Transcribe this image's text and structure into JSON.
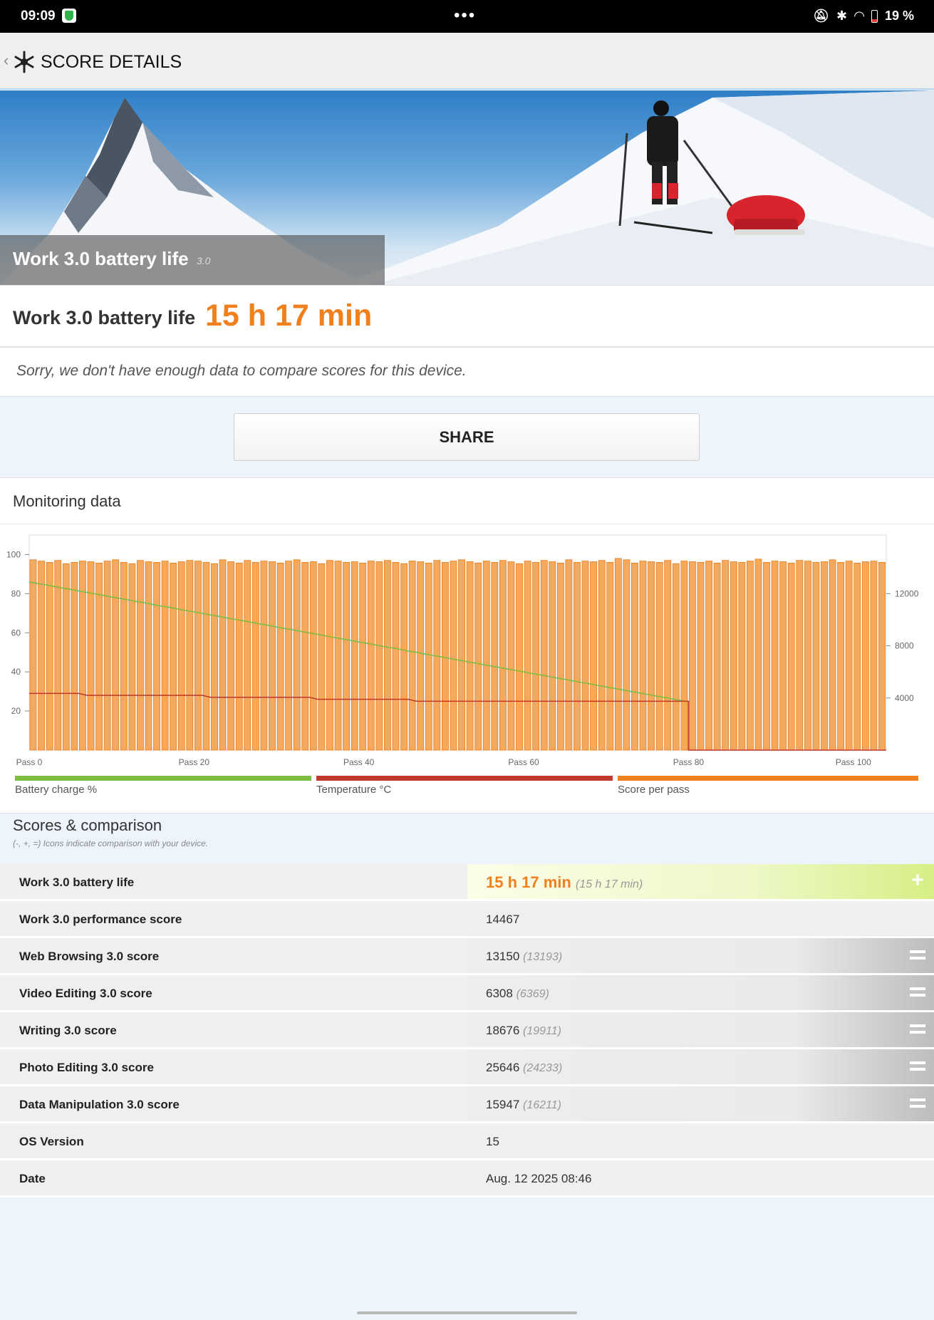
{
  "status_bar": {
    "time": "09:09",
    "battery": "19 %"
  },
  "app_bar": {
    "title": "SCORE DETAILS"
  },
  "hero": {
    "title": "Work 3.0 battery life",
    "version": "3.0"
  },
  "result": {
    "label": "Work 3.0 battery life",
    "value": "15 h 17 min"
  },
  "compare_message": "Sorry, we don't have enough data to compare scores for this device.",
  "share_label": "SHARE",
  "monitoring": {
    "title": "Monitoring data",
    "legend": [
      {
        "name": "Battery charge %",
        "color": "#7dbd42"
      },
      {
        "name": "Temperature °C",
        "color": "#c0392b"
      },
      {
        "name": "Score per pass",
        "color": "#f07f1d"
      }
    ]
  },
  "chart_data": {
    "type": "bar",
    "passes": 104,
    "x_ticks": [
      "Pass 0",
      "Pass 20",
      "Pass 40",
      "Pass 60",
      "Pass 80",
      "Pass 100"
    ],
    "left_axis": {
      "ticks": [
        20,
        40,
        60,
        80,
        100
      ],
      "range": [
        0,
        110
      ]
    },
    "right_axis": {
      "ticks": [
        4000,
        8000,
        12000
      ],
      "range": [
        0,
        16500
      ]
    },
    "series": [
      {
        "name": "Score per pass",
        "axis": "right",
        "base": 14467,
        "values": [
          14600,
          14500,
          14400,
          14550,
          14300,
          14400,
          14500,
          14450,
          14350,
          14500,
          14600,
          14400,
          14300,
          14550,
          14450,
          14400,
          14500,
          14350,
          14450,
          14550,
          14500,
          14400,
          14300,
          14600,
          14450,
          14350,
          14550,
          14400,
          14500,
          14450,
          14350,
          14500,
          14600,
          14400,
          14450,
          14300,
          14550,
          14500,
          14400,
          14450,
          14350,
          14500,
          14450,
          14550,
          14400,
          14300,
          14500,
          14450,
          14350,
          14550,
          14400,
          14500,
          14600,
          14450,
          14350,
          14500,
          14400,
          14550,
          14450,
          14300,
          14500,
          14400,
          14550,
          14450,
          14350,
          14600,
          14400,
          14500,
          14450,
          14550,
          14400,
          14700,
          14600,
          14350,
          14500,
          14450,
          14400,
          14550,
          14300,
          14500,
          14450,
          14400,
          14500,
          14350,
          14550,
          14450,
          14400,
          14500,
          14650,
          14400,
          14500,
          14450,
          14350,
          14550,
          14500,
          14400,
          14450,
          14600,
          14400,
          14500,
          14350,
          14450,
          14500,
          14400
        ]
      },
      {
        "name": "Battery charge %",
        "axis": "left",
        "values": [
          86,
          85.2,
          84.5,
          83.7,
          82.9,
          82.2,
          81.4,
          80.6,
          79.9,
          79.1,
          78.3,
          77.6,
          76.8,
          76,
          75.3,
          74.5,
          73.7,
          73,
          72.2,
          71.4,
          70.7,
          69.9,
          69.1,
          68.4,
          67.6,
          66.8,
          66.1,
          65.3,
          64.5,
          63.8,
          63,
          62.2,
          61.5,
          60.7,
          59.9,
          59.2,
          58.4,
          57.6,
          56.9,
          56.1,
          55.3,
          54.6,
          53.8,
          53,
          52.3,
          51.5,
          50.7,
          50,
          49.2,
          48.4,
          47.7,
          46.9,
          46.1,
          45.4,
          44.6,
          43.8,
          43.1,
          42.3,
          41.5,
          40.8,
          40,
          39.2,
          38.5,
          37.7,
          36.9,
          36.2,
          35.4,
          34.6,
          33.9,
          33.1,
          32.3,
          31.6,
          30.8,
          30,
          29.3,
          28.5,
          27.7,
          27,
          26.2,
          25.4,
          24.7
        ]
      },
      {
        "name": "Temperature °C",
        "axis": "left",
        "values": [
          29,
          29,
          29,
          29,
          29,
          29,
          29,
          28,
          28,
          28,
          28,
          28,
          28,
          28,
          28,
          28,
          28,
          28,
          28,
          28,
          28,
          28,
          27,
          27,
          27,
          27,
          27,
          27,
          27,
          27,
          27,
          27,
          27,
          27,
          27,
          26,
          26,
          26,
          26,
          26,
          26,
          26,
          26,
          26,
          26,
          26,
          26,
          25,
          25,
          25,
          25,
          25,
          25,
          25,
          25,
          25,
          25,
          25,
          25,
          25,
          25,
          25,
          25,
          25,
          25,
          25,
          25,
          25,
          25,
          25,
          25,
          25,
          25,
          25,
          25,
          25,
          25,
          25,
          25,
          25,
          25
        ]
      }
    ]
  },
  "scores": {
    "title": "Scores & comparison",
    "subtitle": "(-, +, =) Icons indicate comparison with your device.",
    "rows": [
      {
        "label": "Work 3.0 battery life",
        "value": "15 h 17 min",
        "compare": "(15 h 17 min)",
        "indicator": "+"
      },
      {
        "label": "Work 3.0 performance score",
        "value": "14467"
      },
      {
        "label": "Web Browsing 3.0 score",
        "value": "13150",
        "compare": "(13193)",
        "indicator": "="
      },
      {
        "label": "Video Editing 3.0 score",
        "value": "6308",
        "compare": "(6369)",
        "indicator": "="
      },
      {
        "label": "Writing 3.0 score",
        "value": "18676",
        "compare": "(19911)",
        "indicator": "="
      },
      {
        "label": "Photo Editing 3.0 score",
        "value": "25646",
        "compare": "(24233)",
        "indicator": "="
      },
      {
        "label": "Data Manipulation 3.0 score",
        "value": "15947",
        "compare": "(16211)",
        "indicator": "="
      },
      {
        "label": "OS Version",
        "value": "15"
      },
      {
        "label": "Date",
        "value": "Aug. 12 2025 08:46"
      }
    ]
  }
}
